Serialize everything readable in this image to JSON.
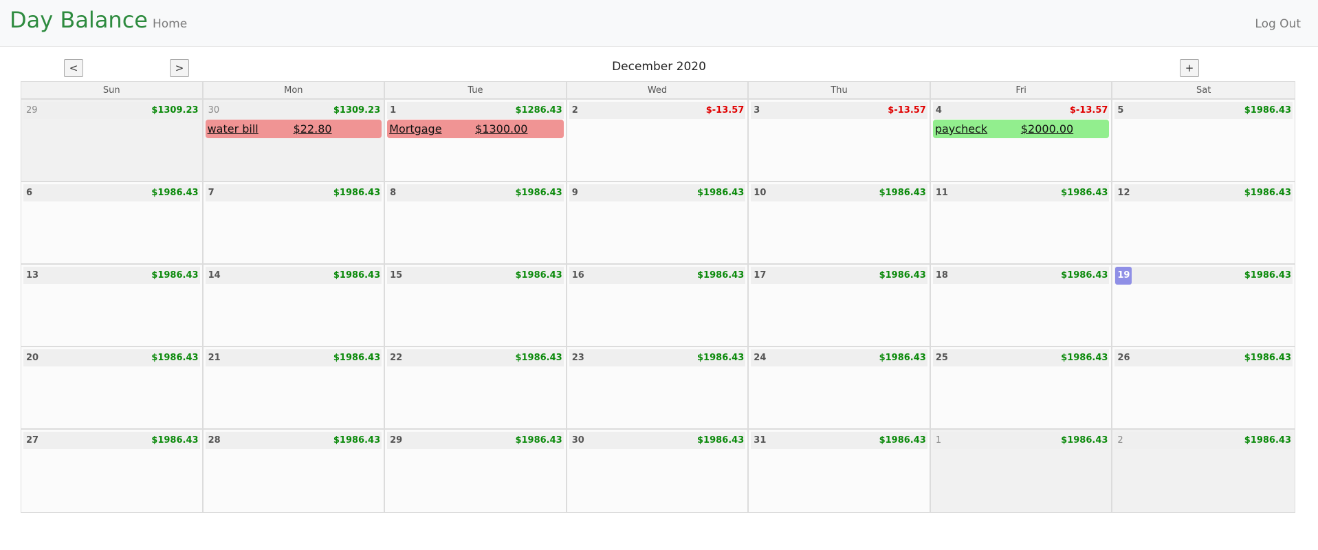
{
  "navbar": {
    "brand": "Day Balance",
    "home": "Home",
    "logout": "Log Out"
  },
  "toolbar": {
    "prev": "<",
    "next": ">",
    "add": "+",
    "month_title": "December 2020"
  },
  "weekdays": [
    "Sun",
    "Mon",
    "Tue",
    "Wed",
    "Thu",
    "Fri",
    "Sat"
  ],
  "colors": {
    "positive": "#0b8a0b",
    "negative": "#e00000",
    "expense_event": "#f09494",
    "income_event": "#92ee8e",
    "today_badge": "#8f8fe6",
    "brand": "#2e8b3f"
  },
  "weeks": [
    [
      {
        "day": "29",
        "balance": "$1309.23",
        "other_month": true,
        "events": []
      },
      {
        "day": "30",
        "balance": "$1309.23",
        "other_month": true,
        "events": [
          {
            "name": "water bill",
            "amount": "$22.80",
            "type": "expense"
          }
        ]
      },
      {
        "day": "1",
        "balance": "$1286.43",
        "events": [
          {
            "name": "Mortgage",
            "amount": "$1300.00",
            "type": "expense"
          }
        ]
      },
      {
        "day": "2",
        "balance": "$-13.57",
        "negative": true,
        "events": []
      },
      {
        "day": "3",
        "balance": "$-13.57",
        "negative": true,
        "events": []
      },
      {
        "day": "4",
        "balance": "$-13.57",
        "negative": true,
        "events": [
          {
            "name": "paycheck",
            "amount": "$2000.00",
            "type": "income"
          }
        ]
      },
      {
        "day": "5",
        "balance": "$1986.43",
        "events": []
      }
    ],
    [
      {
        "day": "6",
        "balance": "$1986.43",
        "events": []
      },
      {
        "day": "7",
        "balance": "$1986.43",
        "events": []
      },
      {
        "day": "8",
        "balance": "$1986.43",
        "events": []
      },
      {
        "day": "9",
        "balance": "$1986.43",
        "events": []
      },
      {
        "day": "10",
        "balance": "$1986.43",
        "events": []
      },
      {
        "day": "11",
        "balance": "$1986.43",
        "events": []
      },
      {
        "day": "12",
        "balance": "$1986.43",
        "events": []
      }
    ],
    [
      {
        "day": "13",
        "balance": "$1986.43",
        "events": []
      },
      {
        "day": "14",
        "balance": "$1986.43",
        "events": []
      },
      {
        "day": "15",
        "balance": "$1986.43",
        "events": []
      },
      {
        "day": "16",
        "balance": "$1986.43",
        "events": []
      },
      {
        "day": "17",
        "balance": "$1986.43",
        "events": []
      },
      {
        "day": "18",
        "balance": "$1986.43",
        "events": []
      },
      {
        "day": "19",
        "balance": "$1986.43",
        "today": true,
        "events": []
      }
    ],
    [
      {
        "day": "20",
        "balance": "$1986.43",
        "events": []
      },
      {
        "day": "21",
        "balance": "$1986.43",
        "events": []
      },
      {
        "day": "22",
        "balance": "$1986.43",
        "events": []
      },
      {
        "day": "23",
        "balance": "$1986.43",
        "events": []
      },
      {
        "day": "24",
        "balance": "$1986.43",
        "events": []
      },
      {
        "day": "25",
        "balance": "$1986.43",
        "events": []
      },
      {
        "day": "26",
        "balance": "$1986.43",
        "events": []
      }
    ],
    [
      {
        "day": "27",
        "balance": "$1986.43",
        "events": []
      },
      {
        "day": "28",
        "balance": "$1986.43",
        "events": []
      },
      {
        "day": "29",
        "balance": "$1986.43",
        "events": []
      },
      {
        "day": "30",
        "balance": "$1986.43",
        "events": []
      },
      {
        "day": "31",
        "balance": "$1986.43",
        "events": []
      },
      {
        "day": "1",
        "balance": "$1986.43",
        "other_month": true,
        "events": []
      },
      {
        "day": "2",
        "balance": "$1986.43",
        "other_month": true,
        "events": []
      }
    ]
  ]
}
